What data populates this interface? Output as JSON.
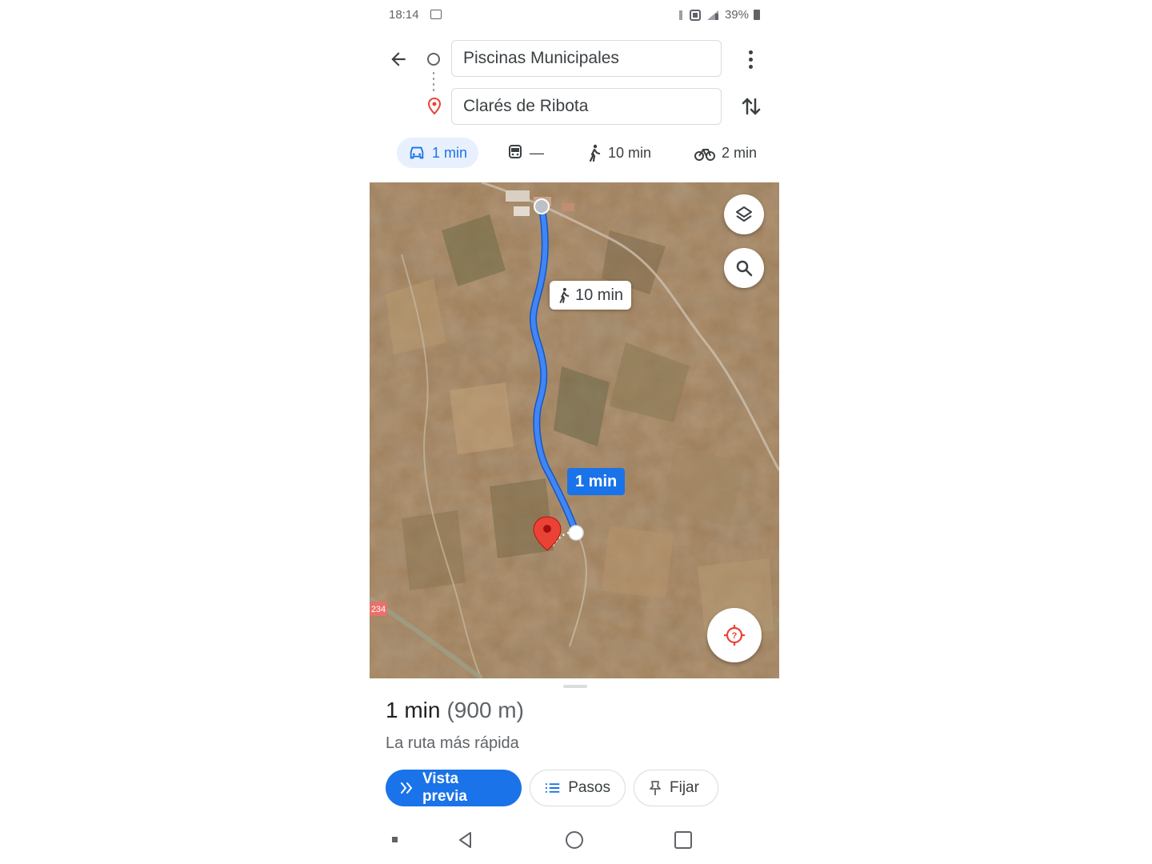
{
  "status_bar": {
    "time": "18:14",
    "battery": "39%"
  },
  "route": {
    "origin": "Piscinas Municipales",
    "destination": "Clarés de Ribota"
  },
  "modes": {
    "car": "1 min",
    "transit": "—",
    "walk": "10 min",
    "bike": "2 min"
  },
  "map": {
    "walk_label": "10 min",
    "drive_label": "1 min",
    "road_shield": "234",
    "route_color": "#1a73e8"
  },
  "sheet": {
    "duration": "1 min",
    "distance": "(900 m)",
    "subtitle": "La ruta más rápida",
    "preview_label": "Vista previa",
    "steps_label": "Pasos",
    "pin_label": "Fijar"
  },
  "colors": {
    "accent": "#1a73e8",
    "pin_red": "#ea4335"
  }
}
